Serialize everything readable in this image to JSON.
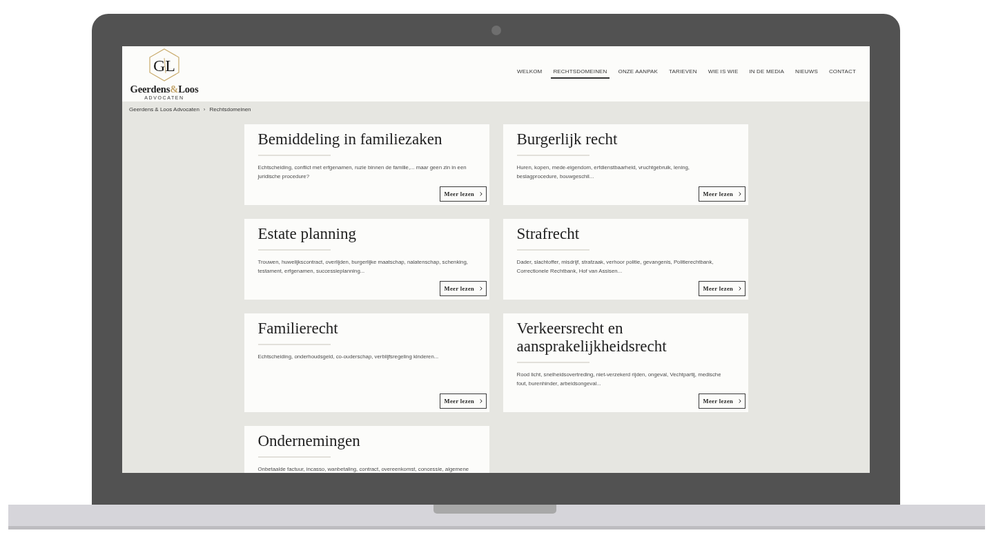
{
  "header": {
    "logo": {
      "monogram": [
        "G",
        "L"
      ],
      "wordmark": [
        {
          "text": "Geerdens",
          "color": "#1e1e1e"
        },
        {
          "text": "&",
          "color": "#c4a56b"
        },
        {
          "text": "Loos",
          "color": "#1e1e1e"
        }
      ],
      "tagline": "ADVOCATEN"
    },
    "nav": [
      {
        "label": "WELKOM",
        "selected": false
      },
      {
        "label": "RECHTSDOMEINEN",
        "selected": true
      },
      {
        "label": "ONZE AANPAK",
        "selected": false
      },
      {
        "label": "TARIEVEN",
        "selected": false
      },
      {
        "label": "WIE IS WIE",
        "selected": false
      },
      {
        "label": "IN DE MEDIA",
        "selected": false
      },
      {
        "label": "NIEUWS",
        "selected": false
      },
      {
        "label": "CONTACT",
        "selected": false
      }
    ]
  },
  "breadcrumb": {
    "items": [
      "Geerdens & Loos Advocaten",
      "Rechtsdomeinen"
    ],
    "separator": "›"
  },
  "cards": [
    {
      "title": "Bemiddeling in familiezaken",
      "description": "Echtscheiding, conflict met erfgenamen, ruzie binnen de familie,... maar geen zin in een juridische procedure?",
      "button": "Meer lezen"
    },
    {
      "title": "Burgerlijk recht",
      "description": "Huren, kopen, mede-eigendom, erfdienstbaarheid, vruchtgebruik, lening, beslagprocedure, bouwgeschil...",
      "button": "Meer lezen"
    },
    {
      "title": "Estate planning",
      "description": "Trouwen, huwelijkscontract, overlijden, burgerlijke maatschap, nalatenschap, schenking, testament, erfgenamen, successieplanning...",
      "button": "Meer lezen"
    },
    {
      "title": "Strafrecht",
      "description": "Dader, slachtoffer, misdrijf, strafzaak, verhoor politie, gevangenis, Politierechtbank, Correctionele Rechtbank, Hof van Assisen...",
      "button": "Meer lezen"
    },
    {
      "title": "Familierecht",
      "description": "Echtscheiding, onderhoudsgeld, co-ouderschap, verblijfsregeling kinderen...",
      "button": "Meer lezen"
    },
    {
      "title": "Verkeersrecht en aansprakelijkheidsrecht",
      "description": "Rood licht, snelheidsovertreding, niet-verzekerd rijden, ongeval, Vechtpartij, medische fout, burenhinder, arbeidsongeval...",
      "button": "Meer lezen"
    },
    {
      "title": "Ondernemingen",
      "description": "Onbetaalde factuur, incasso, wanbetaling, contract, overeenkomst, concessie, algemene"
    }
  ]
}
